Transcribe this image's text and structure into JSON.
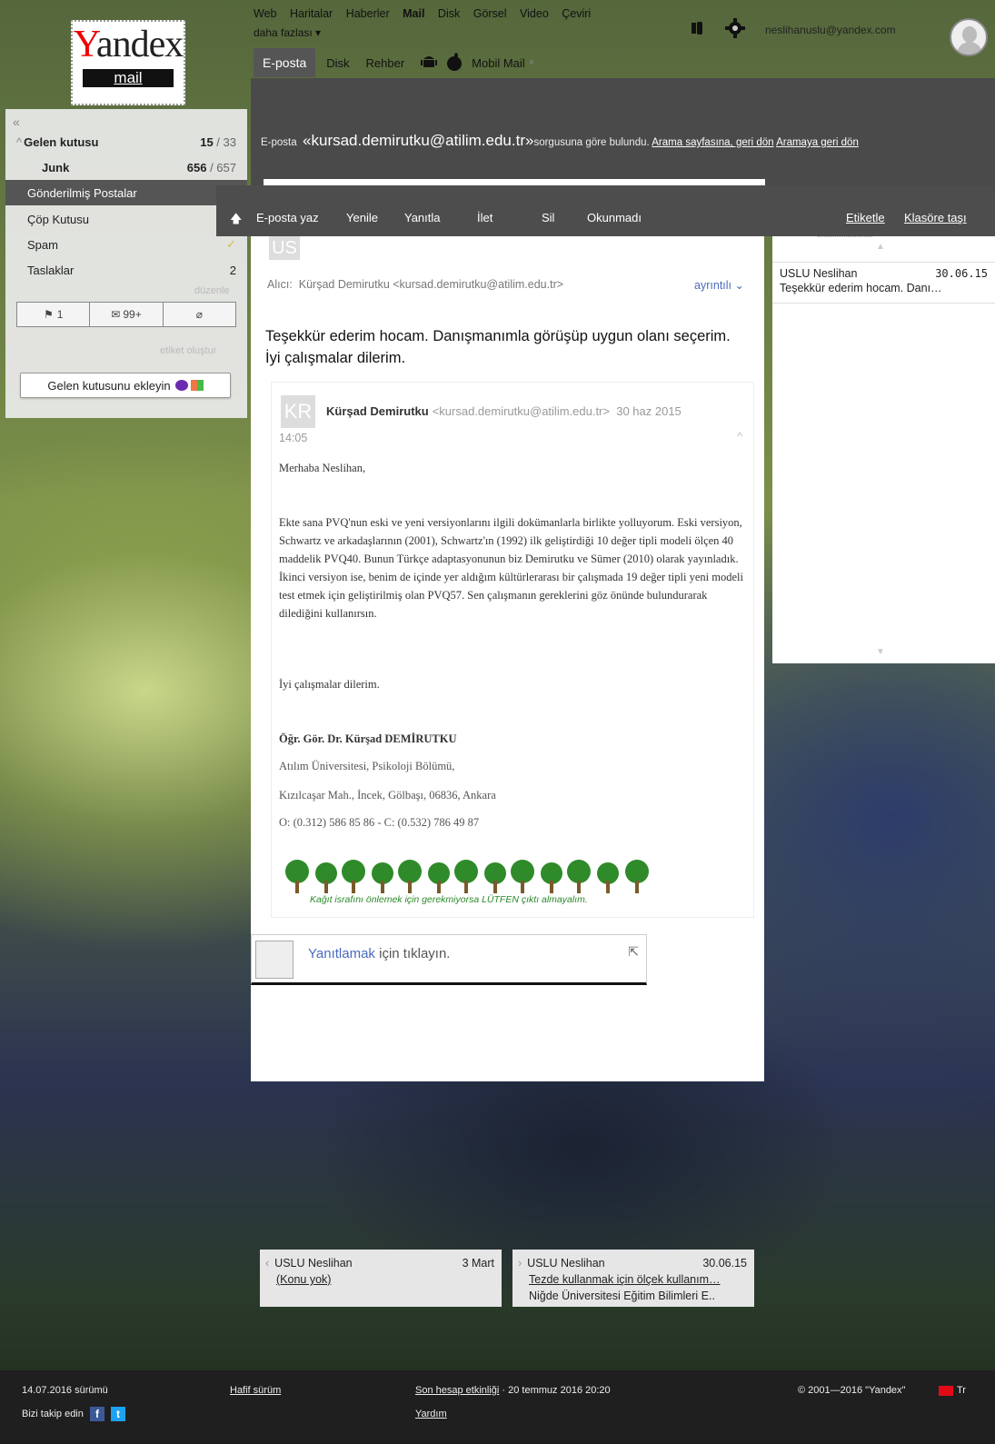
{
  "topnav": {
    "items": [
      "Web",
      "Haritalar",
      "Haberler",
      "Mail",
      "Disk",
      "Görsel",
      "Video",
      "Çeviri"
    ],
    "more": "daha fazlası ▾"
  },
  "tabs": {
    "eposta": "E-posta",
    "disk": "Disk",
    "rehber": "Rehber",
    "mobil": "Mobil Mail",
    "close": "×"
  },
  "user": {
    "email": "neslihanuslu@yandex.com"
  },
  "logo": {
    "wordmark_a": "Y",
    "wordmark_b": "andex",
    "mail": "mail"
  },
  "sidebar": {
    "collapse": "«",
    "folders": [
      {
        "label": "Gelen kutusu",
        "unread": "15",
        "total": "33"
      },
      {
        "label": "Junk",
        "unread": "656",
        "total": "657"
      },
      {
        "label": "Gönderilmiş Postalar"
      },
      {
        "label": "Çöp Kutusu"
      },
      {
        "label": "Spam"
      },
      {
        "label": "Taslaklar",
        "count": "2"
      }
    ],
    "sep": " / ",
    "duzenle": "düzenle",
    "filters": {
      "flag": "1",
      "unread": "99+"
    },
    "etiket": "etiket oluştur",
    "add_inbox": "Gelen kutusunu ekleyin"
  },
  "search": {
    "prefix": "E-posta",
    "query": "«kursad.demirutku@atilim.edu.tr»",
    "suffix": "sorgusuna göre bulundu.",
    "back_link": "Arama sayfasına, geri dön",
    "back_link2": "Aramaya geri dön"
  },
  "toolbar": {
    "compose": "E-posta yaz",
    "refresh": "Yenile",
    "reply": "Yanıtla",
    "forward": "İlet",
    "delete": "Sil",
    "unread": "Okunmadı",
    "label": "Etiketle",
    "move": "Klasöre taşı"
  },
  "message": {
    "avatar": "US",
    "to_label": "Alıcı:",
    "to_value": "Kürşad Demirutku <kursad.demirutku@atilim.edu.tr>",
    "details": "ayrıntılı",
    "text": "Teşekkür ederim hocam. Danışmanımla görüşüp uygun olanı seçerim. İyi çalışmalar dilerim.",
    "quote": {
      "avatar": "KR",
      "name": "Kürşad Demirutku",
      "email": "<kursad.demirutku@atilim.edu.tr>",
      "date": "30 haz 2015",
      "time": "14:05",
      "greeting": "Merhaba Neslihan,",
      "para": "Ekte sana PVQ'nun eski ve yeni versiyonlarını ilgili dokümanlarla birlikte yolluyorum. Eski versiyon, Schwartz ve arkadaşlarının (2001), Schwartz'ın (1992) ilk geliştirdiği 10 değer tipli modeli ölçen 40 maddelik PVQ40. Bunun Türkçe adaptasyonunun biz Demirutku ve Sümer (2010) olarak yayınladık. İkinci versiyon ise, benim de içinde yer aldığım kültürlerarası bir çalışmada 19 değer tipli yeni modeli test etmek için geliştirilmiş olan PVQ57. Sen çalışmanın gereklerini göz önünde bulundurarak dilediğini kullanırsın.",
      "closing": "İyi çalışmalar dilerim.",
      "sig_name": "Öğr. Gör. Dr. Kürşad DEMİRUTKU",
      "sig_dept": "Atılım Üniversitesi, Psikoloji Bölümü,",
      "sig_addr": "Kızılcaşar Mah., İncek, Gölbaşı, 06836, Ankara",
      "sig_phone": "O: (0.312) 586 85 86 - C: (0.532) 786 49 87",
      "tree_caption": "Kağıt israfını önlemek için gerekmiyorsa LÜTFEN çıktı almayalım."
    }
  },
  "reply": {
    "link": "Yanıtlamak",
    "rest": " için tıklayın."
  },
  "nav": {
    "prev": {
      "marker": "‹",
      "from": "USLU Neslihan",
      "date": "3 Mart",
      "subject": "(Konu yok)"
    },
    "next": {
      "marker": "›",
      "from": "USLU Neslihan",
      "date": "30.06.15",
      "subject": "Tezde kullanmak için ölçek kullanım…",
      "snippet": "Niğde Üniversitesi Eğitim Bilimleri E.."
    }
  },
  "thread": {
    "from": "USLU Neslihan",
    "date": "30.06.15",
    "snippet": "Teşekkür ederim hocam. Danı…"
  },
  "footer": {
    "version": "14.07.2016 sürümü",
    "follow": "Bizi takip edin",
    "light": "Hafif sürüm",
    "last_activity": "Son hesap etkinliği",
    "last_activity_date": " · 20 temmuz 2016 20:20",
    "help": "Yardım",
    "copyright": "© 2001—2016 \"Yandex\"",
    "lang": "Tr"
  },
  "colors": {
    "accent_link": "#4a6bbd",
    "dark_panel": "#4a4a4a",
    "selected_folder": "#555555"
  }
}
